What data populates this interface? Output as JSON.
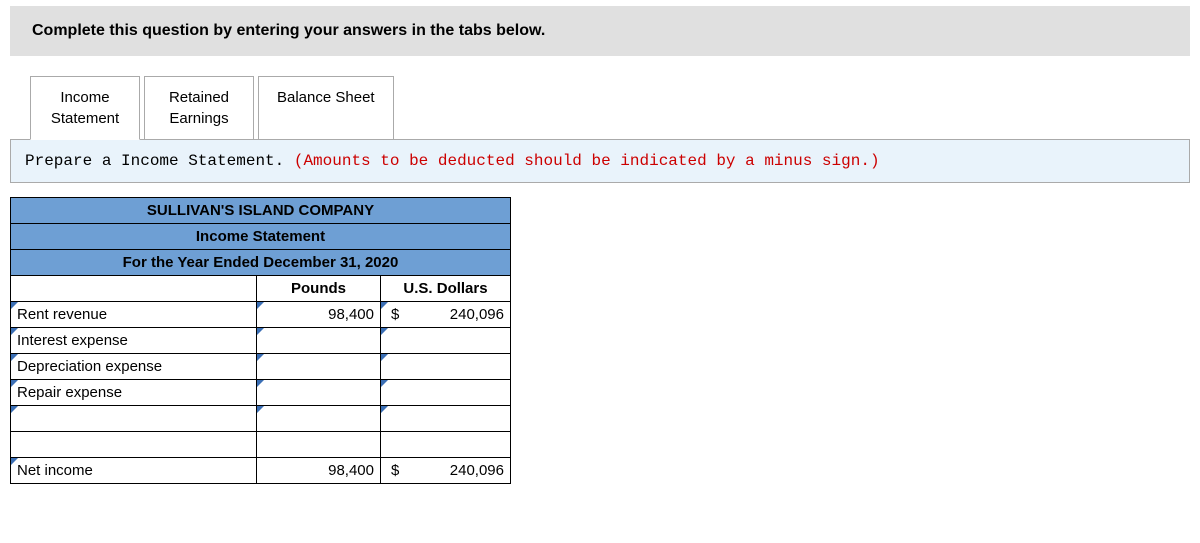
{
  "instruction": "Complete this question by entering your answers in the tabs below.",
  "tabs": {
    "income": "Income\nStatement",
    "retained": "Retained\nEarnings",
    "balance": "Balance Sheet"
  },
  "prompt": {
    "black": "Prepare a Income Statement. ",
    "red": "(Amounts to be deducted should be indicated by a minus sign.)"
  },
  "sheet": {
    "company": "SULLIVAN'S ISLAND COMPANY",
    "title": "Income Statement",
    "period": "For the Year Ended December 31, 2020",
    "col_pounds": "Pounds",
    "col_usd": "U.S. Dollars",
    "rows": [
      {
        "label": "Rent revenue",
        "pounds": "98,400",
        "usd_sym": "$",
        "usd": "240,096"
      },
      {
        "label": "Interest expense",
        "pounds": "",
        "usd_sym": "",
        "usd": ""
      },
      {
        "label": "Depreciation expense",
        "pounds": "",
        "usd_sym": "",
        "usd": ""
      },
      {
        "label": "Repair expense",
        "pounds": "",
        "usd_sym": "",
        "usd": ""
      },
      {
        "label": "",
        "pounds": "",
        "usd_sym": "",
        "usd": ""
      }
    ],
    "total": {
      "label": "Net income",
      "pounds": "98,400",
      "usd_sym": "$",
      "usd": "240,096"
    }
  }
}
